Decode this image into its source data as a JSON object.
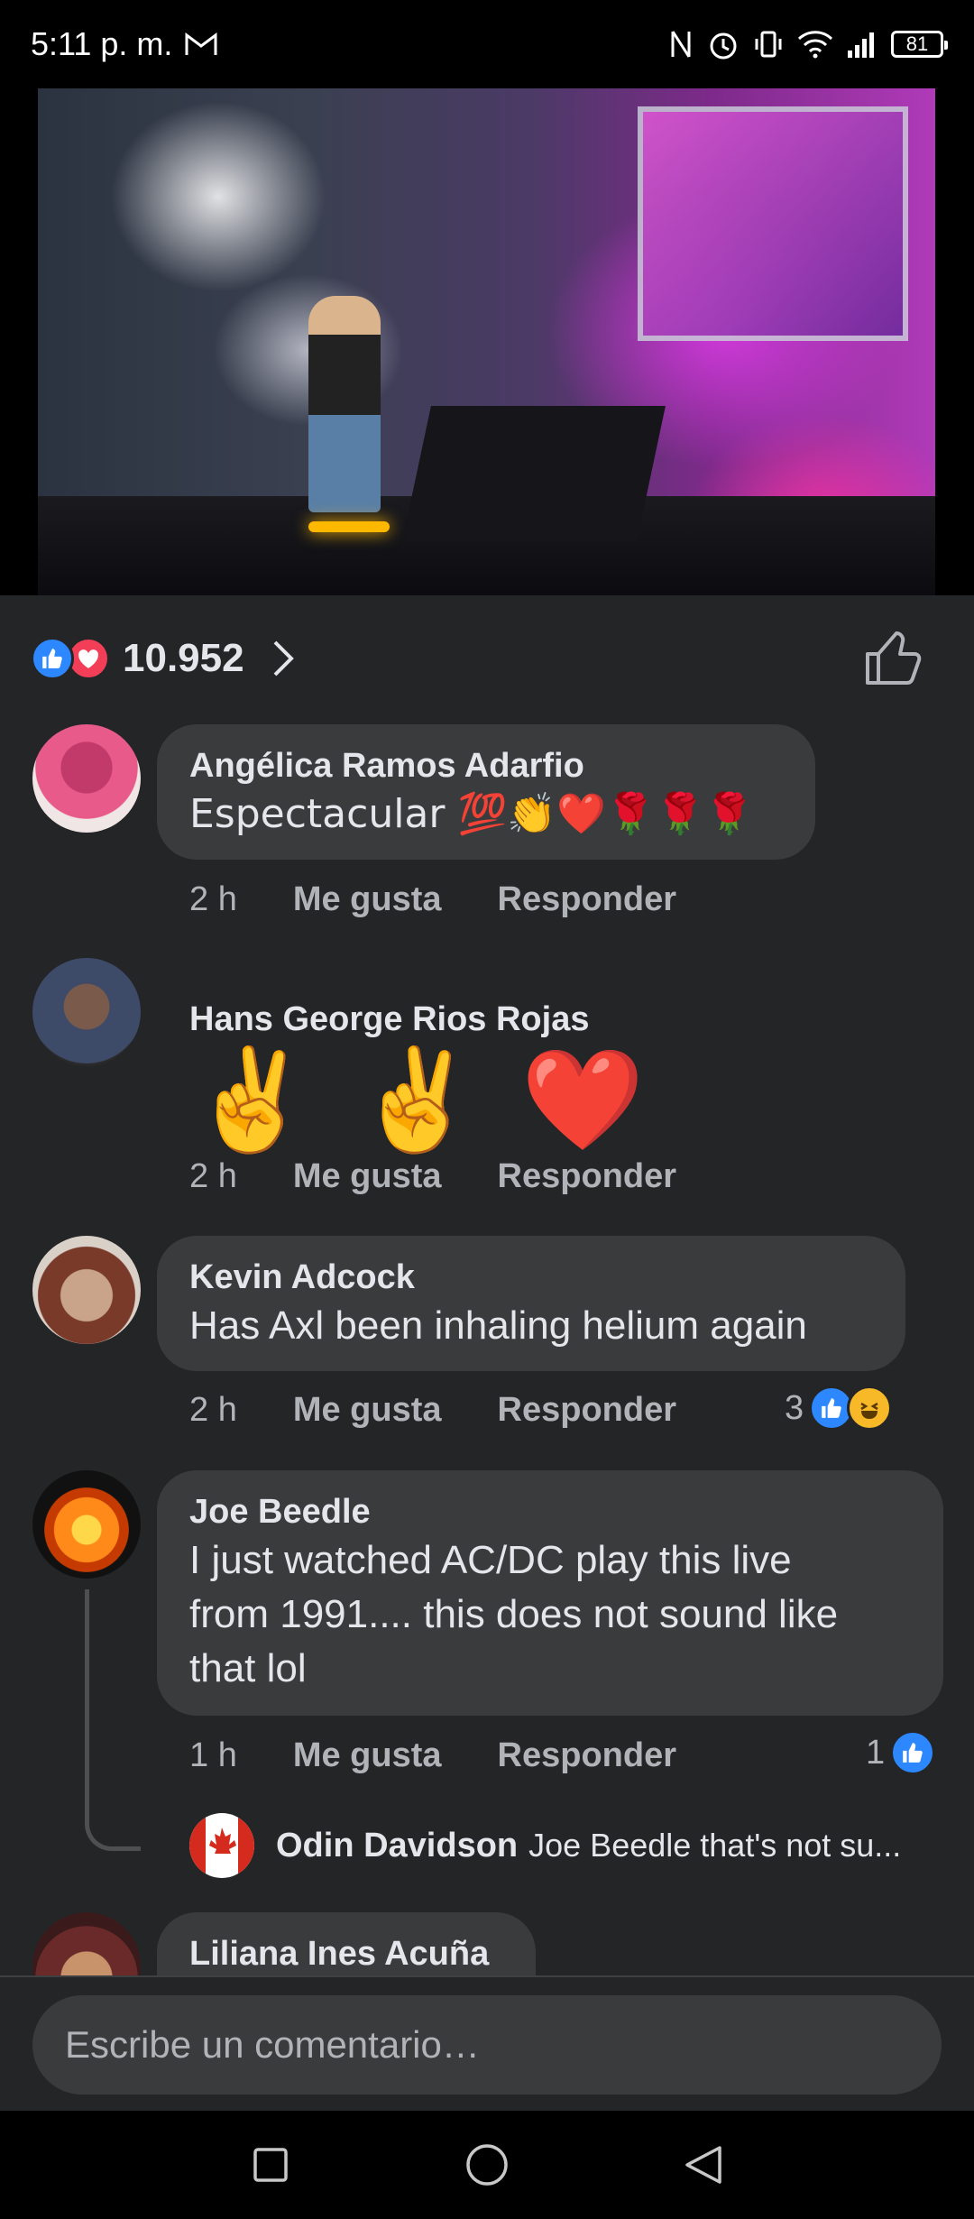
{
  "status_bar": {
    "time": "5:11 p. m.",
    "battery": "81",
    "icons": [
      "gmail-icon",
      "nfc-icon",
      "alarm-icon",
      "vibrate-icon",
      "wifi-icon",
      "signal-icon",
      "battery-icon"
    ]
  },
  "video": {
    "description_icon": "video-player"
  },
  "reactions": {
    "count": "10.952",
    "icons": [
      "like-reaction-icon",
      "love-reaction-icon"
    ]
  },
  "comments": [
    {
      "name": "Angélica Ramos Adarfio",
      "text": "Espectacular 💯👏❤️🌹🌹🌹",
      "time": "2 h",
      "like_label": "Me gusta",
      "reply_label": "Responder"
    },
    {
      "name": "Hans George Rios Rojas",
      "text": "✌️ ✌️ ❤️",
      "time": "2 h",
      "like_label": "Me gusta",
      "reply_label": "Responder"
    },
    {
      "name": "Kevin Adcock",
      "text": "Has Axl been inhaling helium again",
      "time": "2 h",
      "like_label": "Me gusta",
      "reply_label": "Responder",
      "reaction_count": "3"
    },
    {
      "name": "Joe Beedle",
      "text_lines": [
        "I just watched AC/DC play this live",
        "from 1991.... this does not sound like",
        "that lol"
      ],
      "time": "1 h",
      "like_label": "Me gusta",
      "reply_label": "Responder",
      "reaction_count": "1",
      "reply": {
        "name": "Odin Davidson",
        "text": "Joe Beedle that's not su..."
      }
    },
    {
      "name": "Liliana Ines Acuña"
    }
  ],
  "composer": {
    "placeholder": "Escribe un comentario…"
  },
  "nav": {
    "icons": [
      "recents-square-icon",
      "home-circle-icon",
      "back-triangle-icon"
    ]
  },
  "colors": {
    "background": "#242526",
    "bubble": "#3a3b3c",
    "like_blue": "#2d88ff",
    "love_red": "#f33e58",
    "muted_text": "#b0b3b8"
  }
}
